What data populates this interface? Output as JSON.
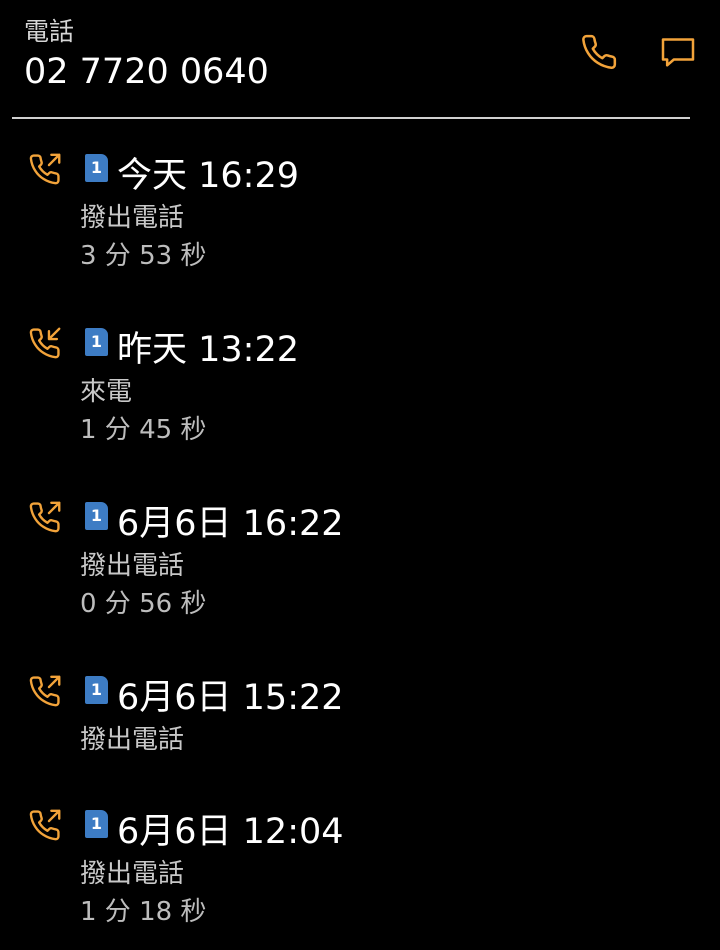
{
  "colors": {
    "accent": "#f2a33a",
    "background": "#000000",
    "sim_badge": "#3d7cc4",
    "primary_text": "#ffffff",
    "secondary_text": "#c8c8c8"
  },
  "header": {
    "label": "電話",
    "number": "02 7720 0640",
    "call_icon": "phone-icon",
    "message_icon": "message-icon"
  },
  "calls": [
    {
      "direction": "outgoing",
      "icon": "outgoing-call-icon",
      "sim": "1",
      "time": "今天 16:29",
      "type": "撥出電話",
      "duration": "3 分 53 秒"
    },
    {
      "direction": "incoming",
      "icon": "incoming-call-icon",
      "sim": "1",
      "time": "昨天 13:22",
      "type": "來電",
      "duration": "1 分 45 秒"
    },
    {
      "direction": "outgoing",
      "icon": "outgoing-call-icon",
      "sim": "1",
      "time": "6月6日 16:22",
      "type": "撥出電話",
      "duration": "0 分 56 秒"
    },
    {
      "direction": "outgoing",
      "icon": "outgoing-call-icon",
      "sim": "1",
      "time": "6月6日 15:22",
      "type": "撥出電話",
      "duration": ""
    },
    {
      "direction": "outgoing",
      "icon": "outgoing-call-icon",
      "sim": "1",
      "time": "6月6日 12:04",
      "type": "撥出電話",
      "duration": "1 分 18 秒"
    }
  ]
}
